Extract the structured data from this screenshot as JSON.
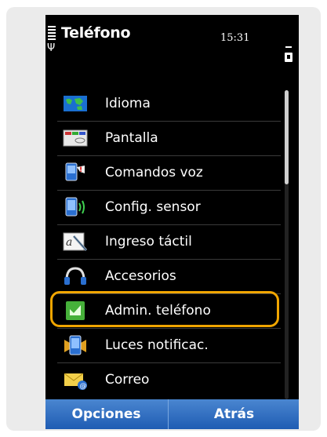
{
  "status_bar": {
    "title": "Teléfono",
    "time": "15:31"
  },
  "menu": {
    "selected_index": 6,
    "items": [
      {
        "label": "Idioma",
        "icon": "globe-map-icon"
      },
      {
        "label": "Pantalla",
        "icon": "display-icon"
      },
      {
        "label": "Comandos voz",
        "icon": "voice-command-icon"
      },
      {
        "label": "Config. sensor",
        "icon": "sensor-icon"
      },
      {
        "label": "Ingreso táctil",
        "icon": "touch-input-icon"
      },
      {
        "label": "Accesorios",
        "icon": "headphones-icon"
      },
      {
        "label": "Admin. teléfono",
        "icon": "phone-admin-icon"
      },
      {
        "label": "Luces notificac.",
        "icon": "notification-lights-icon"
      },
      {
        "label": "Correo",
        "icon": "mail-icon"
      }
    ]
  },
  "softkeys": {
    "left": "Opciones",
    "right": "Atrás"
  },
  "colors": {
    "highlight": "#f0a500",
    "softkey_bar": "#2f6fc4",
    "background": "#000000"
  }
}
